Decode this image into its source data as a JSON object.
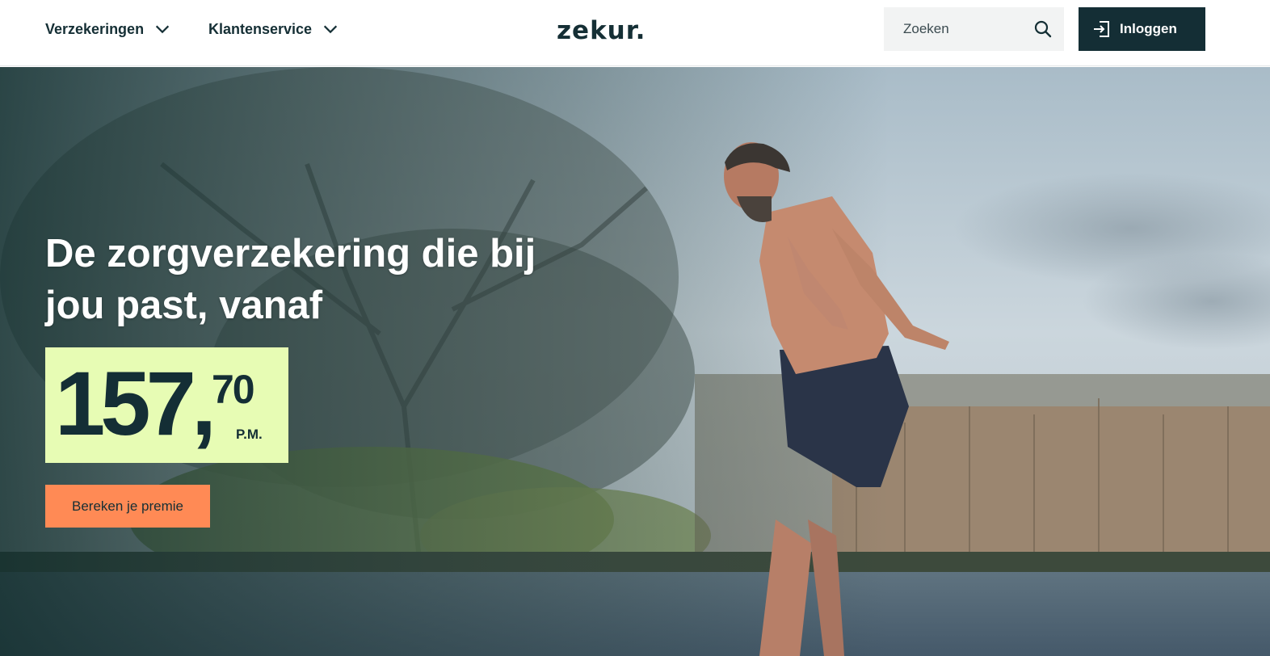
{
  "header": {
    "nav": [
      {
        "label": "Verzekeringen"
      },
      {
        "label": "Klantenservice"
      }
    ],
    "logo_text": "zekur.",
    "search": {
      "placeholder": "Zoeken"
    },
    "login_label": "Inloggen"
  },
  "hero": {
    "title": "De zorgverzekering die bij jou past, vanaf",
    "price": {
      "main": "157,",
      "cents": "70",
      "unit": "P.M."
    },
    "cta_label": "Bereken je premie"
  },
  "colors": {
    "brand_dark": "#142e35",
    "price_bg": "#e7fcb4",
    "cta_bg": "#ff8a55"
  },
  "icons": [
    "chevron-down-icon",
    "search-icon",
    "login-icon"
  ]
}
